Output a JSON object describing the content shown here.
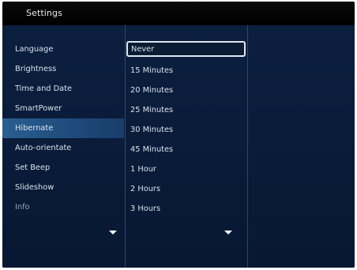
{
  "window": {
    "title": "Settings"
  },
  "menu": {
    "items": [
      {
        "label": "Language"
      },
      {
        "label": "Brightness"
      },
      {
        "label": "Time and Date"
      },
      {
        "label": "SmartPower"
      },
      {
        "label": "Hibernate",
        "selected": true
      },
      {
        "label": "Auto-orientate"
      },
      {
        "label": "Set Beep"
      },
      {
        "label": "Slideshow"
      },
      {
        "label": "Info"
      }
    ]
  },
  "options": {
    "items": [
      {
        "label": "Never",
        "highlighted": true
      },
      {
        "label": "15 Minutes"
      },
      {
        "label": "20 Minutes"
      },
      {
        "label": "25 Minutes"
      },
      {
        "label": "30 Minutes"
      },
      {
        "label": "45 Minutes"
      },
      {
        "label": "1 Hour"
      },
      {
        "label": "2 Hours"
      },
      {
        "label": "3 Hours"
      }
    ]
  },
  "icons": {
    "menu_scroll": "chevron-down-icon",
    "options_scroll": "chevron-down-icon"
  },
  "colors": {
    "background": "#0b1a33",
    "titlebar": "#000000",
    "selected_row": "#2a5f91",
    "text": "#d9e2ee"
  }
}
